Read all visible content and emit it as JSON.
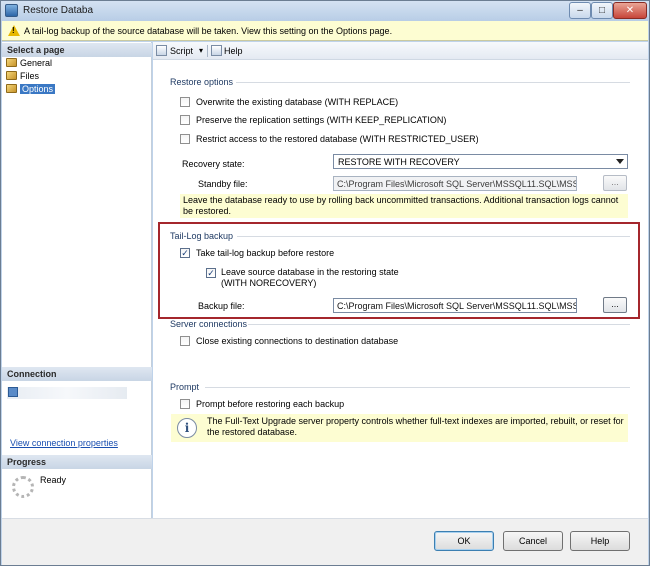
{
  "window": {
    "title": "Restore Databa",
    "controls": {
      "minimize": "–",
      "maximize": "□",
      "close": "✕"
    }
  },
  "info_bar": {
    "icon": "warning-icon",
    "text": "A tail-log backup of the source database will be taken. View this setting on the Options page."
  },
  "left_panel": {
    "select_page_header": "Select a page",
    "pages": [
      {
        "label": "General",
        "selected": false
      },
      {
        "label": "Files",
        "selected": false
      },
      {
        "label": "Options",
        "selected": true
      }
    ],
    "connection_header": "Connection",
    "view_connection_link": "View connection properties",
    "progress_header": "Progress",
    "progress_status": "Ready"
  },
  "toolbar": {
    "script_label": "Script",
    "help_label": "Help"
  },
  "restore_options": {
    "header": "Restore options",
    "overwrite": {
      "label": "Overwrite the existing database (WITH REPLACE)",
      "checked": false
    },
    "preserve": {
      "label": "Preserve the replication settings (WITH KEEP_REPLICATION)",
      "checked": false
    },
    "restrict": {
      "label": "Restrict access to the restored database (WITH RESTRICTED_USER)",
      "checked": false
    },
    "recovery_state_label": "Recovery state:",
    "recovery_state_value": "RESTORE WITH RECOVERY",
    "standby_file_label": "Standby file:",
    "standby_file_value": "C:\\Program Files\\Microsoft SQL Server\\MSSQL11.SQL\\MSSQI",
    "standby_browse": "...",
    "note": "Leave the database ready to use by rolling back uncommitted transactions. Additional transaction logs cannot be restored."
  },
  "tail_log": {
    "header": "Tail-Log backup",
    "take_backup": {
      "label": "Take tail-log backup before restore",
      "checked": true
    },
    "leave_restoring": {
      "label_line1": "Leave source database in the restoring state",
      "label_line2": "(WITH NORECOVERY)",
      "checked": true
    },
    "backup_file_label": "Backup file:",
    "backup_file_value": "C:\\Program Files\\Microsoft SQL Server\\MSSQL11.SQL\\MSSQI",
    "backup_browse": "..."
  },
  "server_connections": {
    "header": "Server connections",
    "close_existing": {
      "label": "Close existing connections to destination database",
      "checked": false
    }
  },
  "prompt": {
    "header": "Prompt",
    "prompt_each": {
      "label": "Prompt before restoring each backup",
      "checked": false
    },
    "info_icon": "information-icon",
    "info_text": "The Full-Text Upgrade server property controls whether full-text indexes are imported, rebuilt, or reset for the restored database."
  },
  "buttons": {
    "ok": "OK",
    "cancel": "Cancel",
    "help": "Help"
  },
  "colors": {
    "highlight_frame": "#a4262c",
    "note_background": "#fdfdd2",
    "selected_page": "#3a78c4"
  }
}
